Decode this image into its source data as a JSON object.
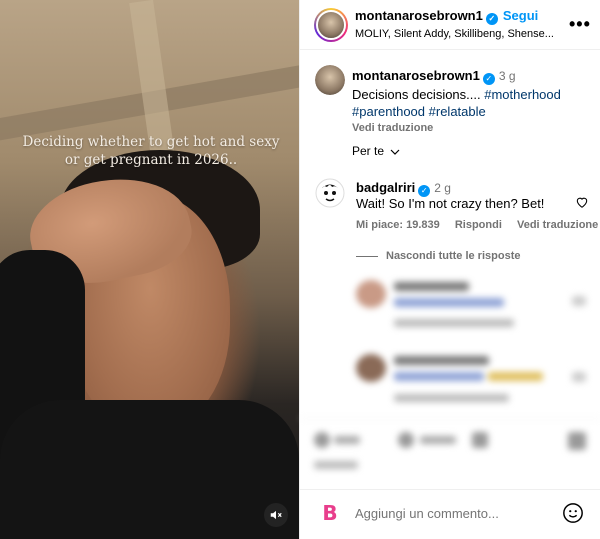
{
  "media": {
    "caption": "Deciding whether to get hot and sexy or get pregnant in 2026..",
    "mute_icon": "speaker-muted-icon"
  },
  "header": {
    "username": "montanarosebrown1",
    "follow_label": "Segui",
    "music": "MOLIY, Silent Addy, Skillibeng, Shense...",
    "more_icon": "more-horizontal-icon",
    "more_label": "•••"
  },
  "post": {
    "username": "montanarosebrown1",
    "time": "3 g",
    "text": "Decisions decisions....",
    "tag1": "#motherhood",
    "tag2": "#parenthood",
    "tag3": "#relatable",
    "translate": "Vedi traduzione"
  },
  "sort": {
    "label": "Per te"
  },
  "comment": {
    "username": "badgalriri",
    "time": "2 g",
    "text": "Wait! So I'm not crazy then? Bet!",
    "likes": "Mi piace: 19.839",
    "reply": "Rispondi",
    "translate": "Vedi traduzione",
    "hide_replies": "Nascondi tutte le risposte"
  },
  "composer": {
    "placeholder": "Aggiungi un commento...",
    "emoji_icon": "smiley-icon"
  },
  "colors": {
    "accent": "#0095f6",
    "hashtag": "#00376b",
    "muted": "#737373"
  }
}
